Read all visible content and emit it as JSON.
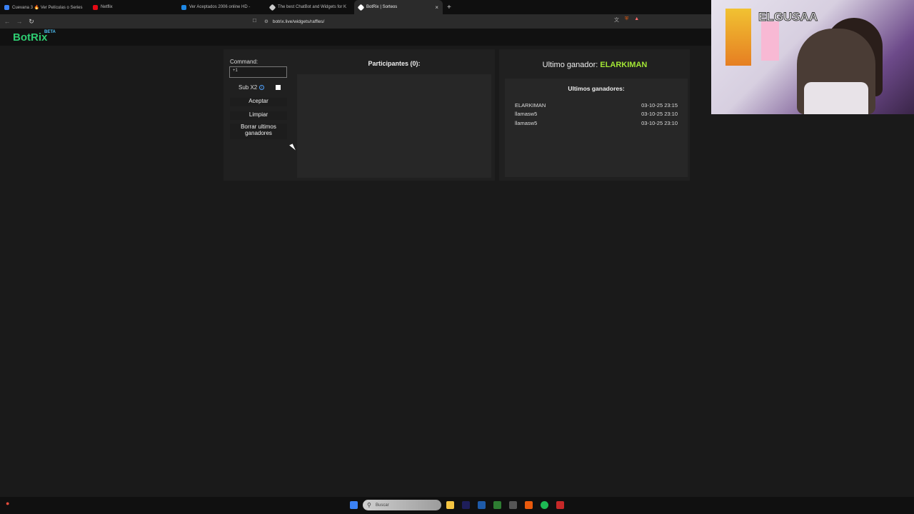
{
  "browser": {
    "tabs": [
      {
        "label": "Cuevana 3 🔥 Ver Películas o Series",
        "color": "#3b82f6",
        "active": false
      },
      {
        "label": "Netflix",
        "color": "#e50914",
        "active": false
      },
      {
        "label": "Ver Aceptados 2006 online HD -",
        "color": "#1e88e5",
        "active": false
      },
      {
        "label": "The best ChatBot and Widgets for K",
        "color": "#cccccc",
        "active": false
      },
      {
        "label": "BotRix | Sorteos",
        "color": "#ffffff",
        "active": true
      }
    ],
    "new_tab": "+",
    "close_tab": "×",
    "url": "botrix.live/widgets/raffles/"
  },
  "app": {
    "logo": "BotRix",
    "beta": "BETA"
  },
  "webcam": {
    "overlay_name": "ELGUSAA"
  },
  "controls": {
    "command_label": "Command:",
    "command_value": "+1",
    "sub_label": "Sub X2",
    "sub_checked": false,
    "accept_button": "Aceptar",
    "clear_button": "Limpiar",
    "delete_button": "Borrar ultimos ganadores"
  },
  "participants": {
    "title": "Participantes (0):"
  },
  "winner": {
    "label": "Ultimo ganador:",
    "name": "ELARKIMAN",
    "recent_title": "Ultimos ganadores:",
    "recent": [
      {
        "name": "ELARKIMAN",
        "time": "03-10-25 23:15"
      },
      {
        "name": "llamasw5",
        "time": "03-10-25 23:10"
      },
      {
        "name": "llamasw5",
        "time": "03-10-25 23:10"
      }
    ]
  },
  "taskbar": {
    "search_placeholder": "Buscar"
  },
  "colors": {
    "brand": "#2ecc71",
    "winner_accent": "#a3e635"
  }
}
